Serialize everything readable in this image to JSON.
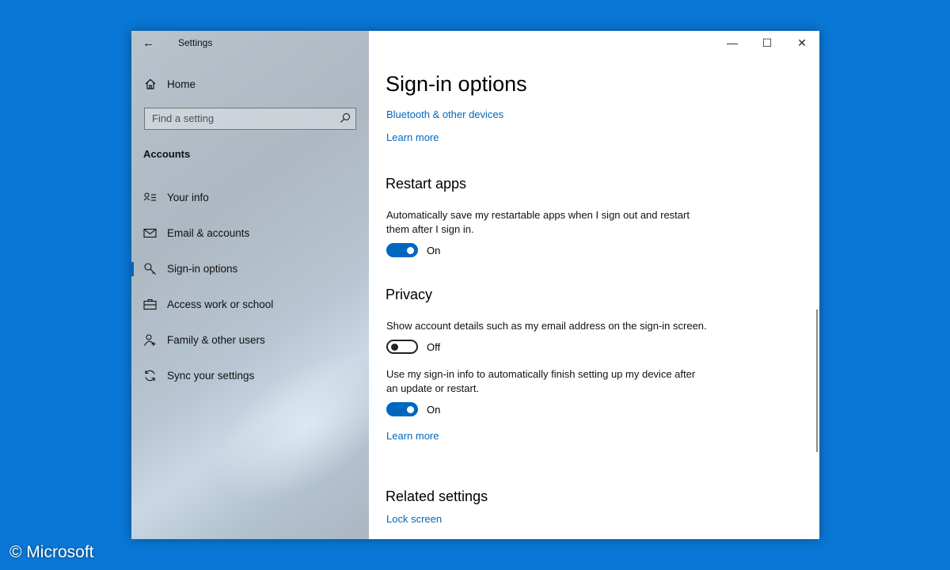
{
  "app": {
    "title": "Settings"
  },
  "window_controls": {
    "minimize": "—",
    "maximize": "☐",
    "close": "✕"
  },
  "sidebar": {
    "home_label": "Home",
    "search_placeholder": "Find a setting",
    "section_label": "Accounts",
    "items": [
      {
        "label": "Your info",
        "icon": "person-card-icon"
      },
      {
        "label": "Email & accounts",
        "icon": "mail-icon"
      },
      {
        "label": "Sign-in options",
        "icon": "key-icon",
        "active": true
      },
      {
        "label": "Access work or school",
        "icon": "briefcase-icon"
      },
      {
        "label": "Family & other users",
        "icon": "person-add-icon"
      },
      {
        "label": "Sync your settings",
        "icon": "sync-icon"
      }
    ]
  },
  "main": {
    "title": "Sign-in options",
    "link_bluetooth": "Bluetooth & other devices",
    "link_learn_more_1": "Learn more",
    "restart": {
      "heading": "Restart apps",
      "description": "Automatically save my restartable apps when I sign out and restart them after I sign in.",
      "toggle_state": "On"
    },
    "privacy": {
      "heading": "Privacy",
      "account_details": {
        "description": "Show account details such as my email address on the sign-in screen.",
        "toggle_state": "Off"
      },
      "signin_info": {
        "description": "Use my sign-in info to automatically finish setting up my device after an update or restart.",
        "toggle_state": "On"
      },
      "learn_more": "Learn more"
    },
    "related": {
      "heading": "Related settings",
      "lock_screen": "Lock screen"
    }
  },
  "watermark": "© Microsoft",
  "colors": {
    "accent": "#0067c0",
    "desktop": "#0a77d6"
  }
}
